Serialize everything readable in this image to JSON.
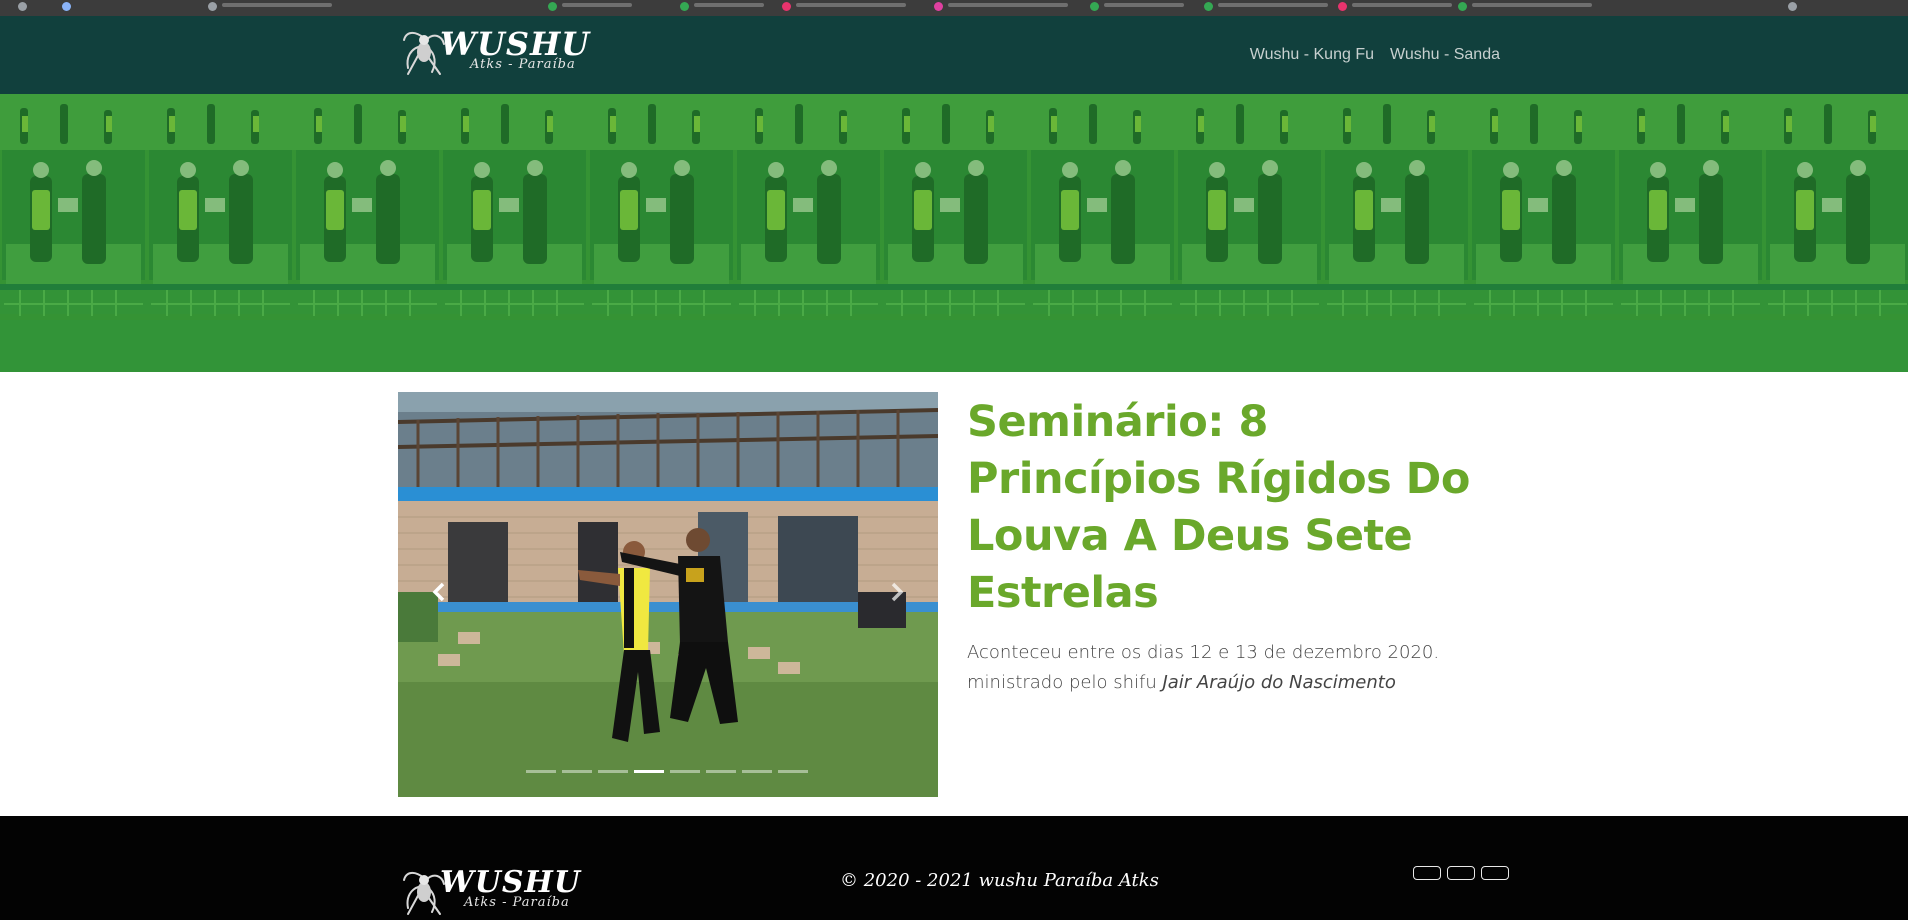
{
  "site": {
    "logo": {
      "word": "WUSHU",
      "sub": "Atks - Paraíba"
    }
  },
  "nav": {
    "links": [
      "Wushu - Kung Fu",
      "Wushu - Sanda"
    ]
  },
  "article": {
    "title": "Seminário: 8 Princípios Rígidos Do Louva A Deus Sete Estrelas",
    "body_text": "Aconteceu entre os dias 12 e 13 de dezembro 2020. ministrado pelo shifu ",
    "instructor": "Jair Araújo do Nascimento"
  },
  "carousel": {
    "prev_icon": "chevron-left-icon",
    "next_icon": "chevron-right-icon",
    "slide_count": 8,
    "active_slide": 4
  },
  "footer": {
    "copyright": "© 2020 - 2021 wushu Paraíba Atks",
    "social_buttons": 3
  },
  "colors": {
    "navbar": "#11403d",
    "hero_overlay": "#2f9a2f",
    "title": "#6aa82b",
    "footer": "#030303"
  }
}
